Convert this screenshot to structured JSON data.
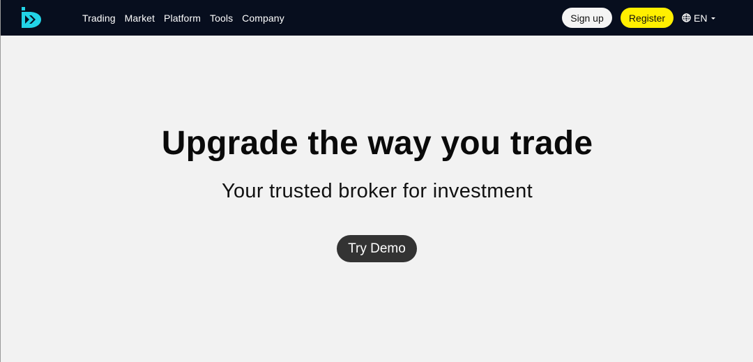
{
  "nav": {
    "logo_icon": "brand-logo-icon",
    "links": [
      "Trading",
      "Market",
      "Platform",
      "Tools",
      "Company"
    ],
    "signup_label": "Sign up",
    "register_label": "Register",
    "language": "EN",
    "language_icon": "globe-icon",
    "caret_icon": "caret-down-icon"
  },
  "hero": {
    "title": "Upgrade the way you trade",
    "subtitle": "Your trusted broker for investment",
    "cta_label": "Try Demo"
  },
  "colors": {
    "nav_bg": "#070e1e",
    "page_bg": "#f2f2f2",
    "brand_accent": "#22d3e6",
    "register_bg": "#ffef00",
    "demo_bg": "#333333"
  }
}
